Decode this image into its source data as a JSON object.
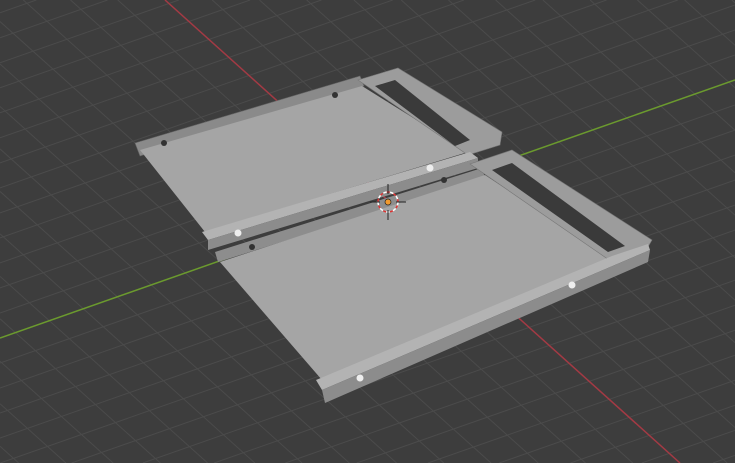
{
  "viewport": {
    "background_color": "#3d3d3d",
    "grid_color": "#4b4b4b",
    "x_axis_color": "#a33a44",
    "y_axis_color": "#6b9a2e",
    "object_color": "#a3a3a3",
    "origin_icon": "object-origin-icon"
  }
}
